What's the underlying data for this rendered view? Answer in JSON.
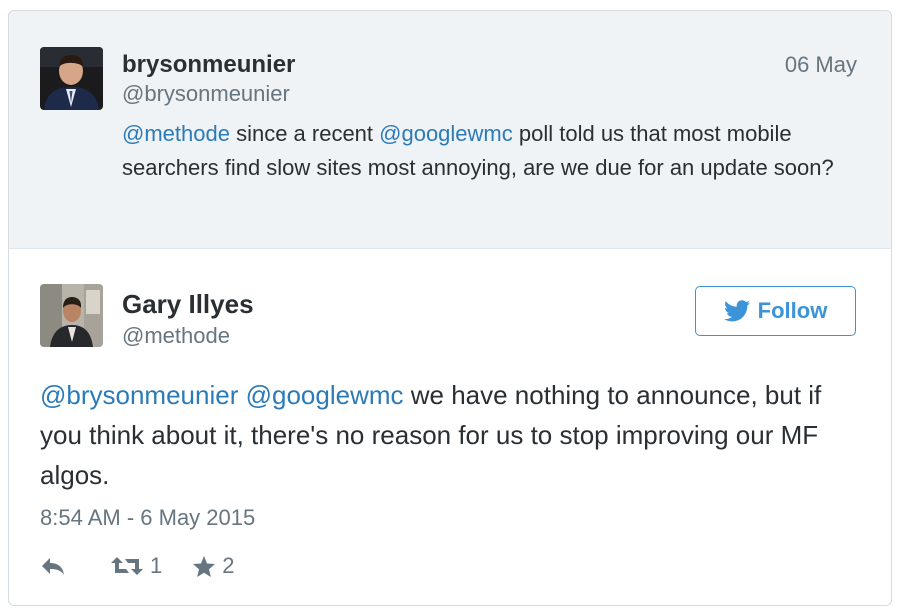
{
  "parent_tweet": {
    "display_name": "brysonmeunier",
    "handle": "@brysonmeunier",
    "date": "06 May",
    "text_segments": [
      {
        "text": "@methode",
        "type": "mention"
      },
      {
        "text": " since a recent ",
        "type": "text"
      },
      {
        "text": "@googlewmc",
        "type": "mention"
      },
      {
        "text": " poll told us that most mobile searchers find slow sites most annoying, are we due for an update soon?",
        "type": "text"
      }
    ]
  },
  "main_tweet": {
    "display_name": "Gary Illyes",
    "handle": "@methode",
    "follow_label": "Follow",
    "text_segments": [
      {
        "text": "@brysonmeunier",
        "type": "mention"
      },
      {
        "text": " ",
        "type": "text"
      },
      {
        "text": "@googlewmc",
        "type": "mention"
      },
      {
        "text": " we have nothing to announce, but if you think about it, there's no reason for us to stop improving our MF algos.",
        "type": "text"
      }
    ],
    "timestamp": "8:54 AM - 6 May 2015",
    "retweet_count": "1",
    "favorite_count": "2"
  },
  "icons": {
    "reply": "reply-icon",
    "retweet": "retweet-icon",
    "favorite": "star-icon",
    "follow": "twitter-bird-icon"
  },
  "colors": {
    "mention": "#2b7bb9",
    "follow_blue": "#3b94d9",
    "parent_bg": "#f0f3f6",
    "muted": "#66757f",
    "text": "#292f33"
  }
}
